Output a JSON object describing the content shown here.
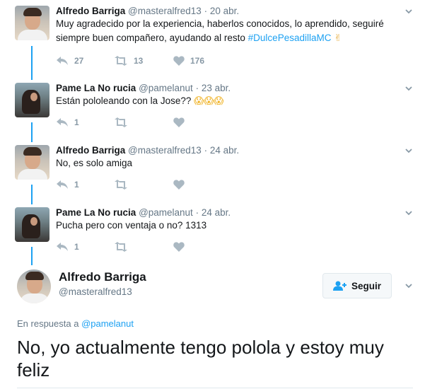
{
  "tweets": [
    {
      "name": "Alfredo Barriga",
      "handle": "@masteralfred13",
      "separator": "·",
      "date": "20 abr.",
      "text": "Muy agradecido por la experiencia, haberlos conocidos, lo aprendido, seguiré siempre buen compañero, ayudando al resto ",
      "hashtag": "#DulcePesadillaMC",
      "emoji": "✌",
      "reply_count": "27",
      "retweet_count": "13",
      "like_count": "176"
    },
    {
      "name": "Pame La No rucia",
      "handle": "@pamelanut",
      "separator": "·",
      "date": "23 abr.",
      "text": "Están pololeando con la Jose?? ",
      "emoji": "😱😱😱",
      "reply_count": "1",
      "retweet_count": "",
      "like_count": ""
    },
    {
      "name": "Alfredo Barriga",
      "handle": "@masteralfred13",
      "separator": "·",
      "date": "24 abr.",
      "text": "No, es solo amiga",
      "reply_count": "1",
      "retweet_count": "",
      "like_count": ""
    },
    {
      "name": "Pame La No rucia",
      "handle": "@pamelanut",
      "separator": "·",
      "date": "24 abr.",
      "text": "Pucha pero con ventaja o no? 1313",
      "reply_count": "1",
      "retweet_count": "",
      "like_count": ""
    }
  ],
  "main_tweet": {
    "name": "Alfredo Barriga",
    "handle": "@masteralfred13",
    "follow_label": "Seguir",
    "reply_prefix": "En respuesta a ",
    "reply_handle": "@pamelanut",
    "text": "No, yo actualmente tengo polola y estoy muy feliz"
  },
  "icons": {
    "reply": "reply-icon",
    "retweet": "retweet-icon",
    "like": "heart-icon",
    "more": "chevron-down-icon",
    "follow": "follow-person-icon"
  },
  "colors": {
    "link": "#1da1f2",
    "muted": "#657786",
    "icon": "#aab8c2",
    "text": "#14171a"
  }
}
